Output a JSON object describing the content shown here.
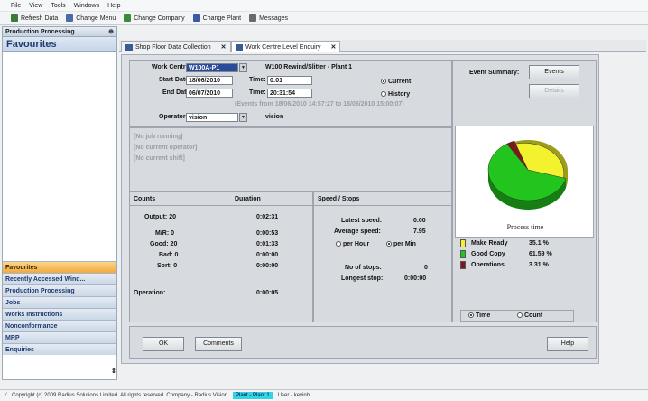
{
  "menu": [
    "File",
    "View",
    "Tools",
    "Windows",
    "Help"
  ],
  "toolbar": [
    {
      "label": "Refresh Data",
      "icon": "refresh-icon",
      "color": "#3a7a3a"
    },
    {
      "label": "Change Menu",
      "icon": "menu-icon",
      "color": "#4a6aa8"
    },
    {
      "label": "Change Company",
      "icon": "company-icon",
      "color": "#3a8a3a"
    },
    {
      "label": "Change Plant",
      "icon": "plant-icon",
      "color": "#3a5aa8"
    },
    {
      "label": "Messages",
      "icon": "messages-icon",
      "color": "#6a6a6a"
    }
  ],
  "left_pane": {
    "title": "Production Processing",
    "pin": "⊕",
    "favourites_title": "Favourites",
    "nav": [
      "Favourites",
      "Recently Accessed Wind...",
      "Production Processing",
      "Jobs",
      "Works Instructions",
      "Nonconformance",
      "MRP",
      "Enquiries"
    ]
  },
  "tabs": [
    {
      "label": "Shop Floor Data Collection",
      "close": "✕"
    },
    {
      "label": "Work Centre Level Enquiry",
      "close": "✕"
    }
  ],
  "form": {
    "work_centre_label": "Work Centre:",
    "work_centre_value": "W100A-P1",
    "work_centre_desc": "W100 Rewind/Slitter - Plant 1",
    "start_date_label": "Start Date:",
    "start_date_value": "18/06/2010",
    "start_time_label": "Time:",
    "start_time_value": "0:01",
    "end_date_label": "End Date:",
    "end_date_value": "06/07/2010",
    "end_time_label": "Time:",
    "end_time_value": "20:31:54",
    "current_label": "Current",
    "history_label": "History",
    "events_range": "(Events from 18/06/2010 14:57:27 to 18/06/2010 15:00:07)",
    "operator_label": "Operator:",
    "operator_value": "vision",
    "operator_name": "vision"
  },
  "status_lines": [
    "[No job running]",
    "[No current operator]",
    "[No current shift]"
  ],
  "counts": {
    "header_counts": "Counts",
    "header_duration": "Duration",
    "rows": [
      {
        "label": "Output: 20",
        "duration": "0:02:31"
      },
      {
        "label": "M/R: 0",
        "duration": "0:00:53"
      },
      {
        "label": "Good: 20",
        "duration": "0:01:33"
      },
      {
        "label": "Bad: 0",
        "duration": "0:00:00"
      },
      {
        "label": "Sort: 0",
        "duration": "0:00:00"
      }
    ],
    "operation_label": "Operation:",
    "operation_duration": "0:00:05"
  },
  "speed": {
    "header": "Speed / Stops",
    "latest_label": "Latest speed:",
    "latest_value": "0.00",
    "average_label": "Average speed:",
    "average_value": "7.95",
    "per_hour": "per Hour",
    "per_min": "per Min",
    "stops_label": "No of stops:",
    "stops_value": "0",
    "longest_label": "Longest stop:",
    "longest_value": "0:00:00"
  },
  "events": {
    "summary_label": "Event Summary:",
    "events_button": "Events",
    "details_button": "Details"
  },
  "chart_data": {
    "type": "pie",
    "title": "Process time",
    "labels": [
      "Make Ready",
      "Good Copy",
      "Operations"
    ],
    "values": [
      35.1,
      61.59,
      3.31
    ],
    "value_labels": [
      "35.1 %",
      "61.59 %",
      "3.31 %"
    ],
    "colors": [
      "#f2f22e",
      "#22c41e",
      "#7a1a1a"
    ]
  },
  "chart_mode": {
    "time_label": "Time",
    "count_label": "Count"
  },
  "buttons": {
    "ok": "OK",
    "comments": "Comments",
    "help": "Help"
  },
  "status_bar": {
    "copyright": "Copyright (c) 2009 Radius Solutions Limited. All rights reserved. Company  -  Radius Vision",
    "plant": "Plant - Plant 1",
    "user": "User - kevinb"
  }
}
